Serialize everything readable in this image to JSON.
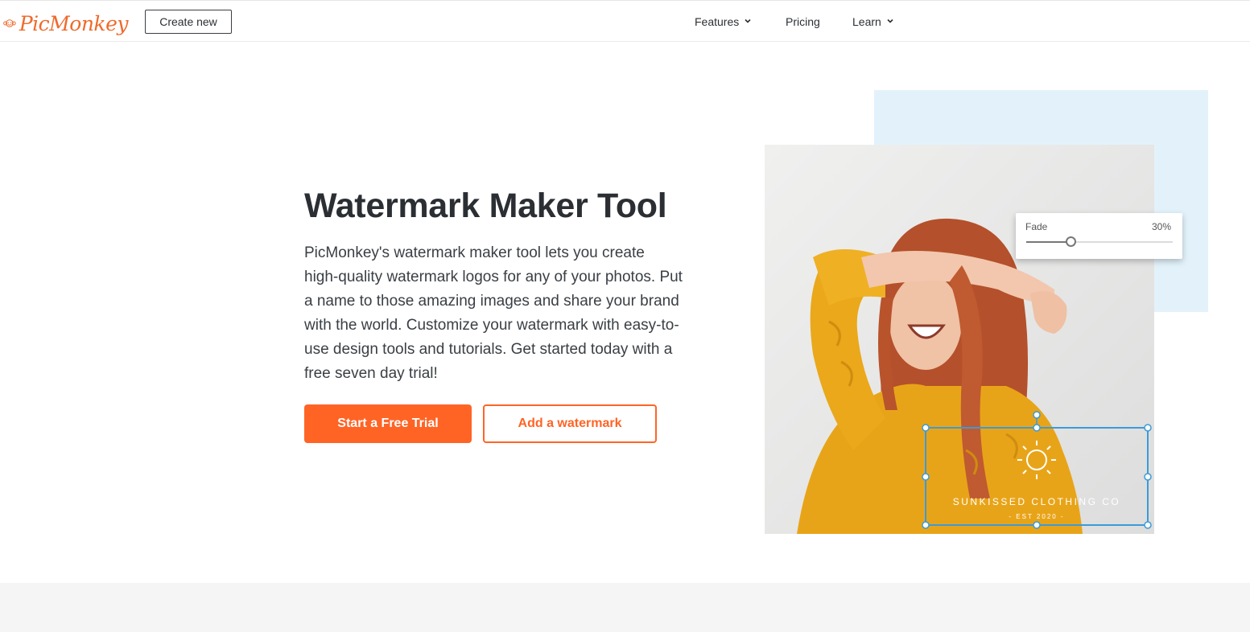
{
  "header": {
    "logo_text": "PicMonkey",
    "create_button": "Create new",
    "nav": [
      {
        "label": "Features",
        "has_dropdown": true
      },
      {
        "label": "Pricing",
        "has_dropdown": false
      },
      {
        "label": "Learn",
        "has_dropdown": true
      }
    ]
  },
  "hero": {
    "title": "Watermark Maker Tool",
    "description": "PicMonkey's watermark maker tool lets you create high-quality watermark logos for any of your photos. Put a name to those amazing images and share your brand with the world. Customize your watermark with easy-to-use design tools and tutorials. Get started today with a free seven day trial!",
    "primary_button": "Start a Free Trial",
    "secondary_button": "Add a watermark"
  },
  "editor_preview": {
    "fade_label": "Fade",
    "fade_value": "30%",
    "fade_level": 0.3,
    "watermark_text": "SUNKISSED CLOTHING CO",
    "watermark_subtext": "- EST 2020 -"
  },
  "colors": {
    "brand": "#ff6425",
    "logo": "#ef6a2b",
    "accent_panel": "#e3f2fa",
    "selection": "#3a9bd9",
    "text": "#2b2f33"
  },
  "icons": [
    "monkey-logo-icon",
    "chevron-down-icon",
    "sun-icon"
  ]
}
